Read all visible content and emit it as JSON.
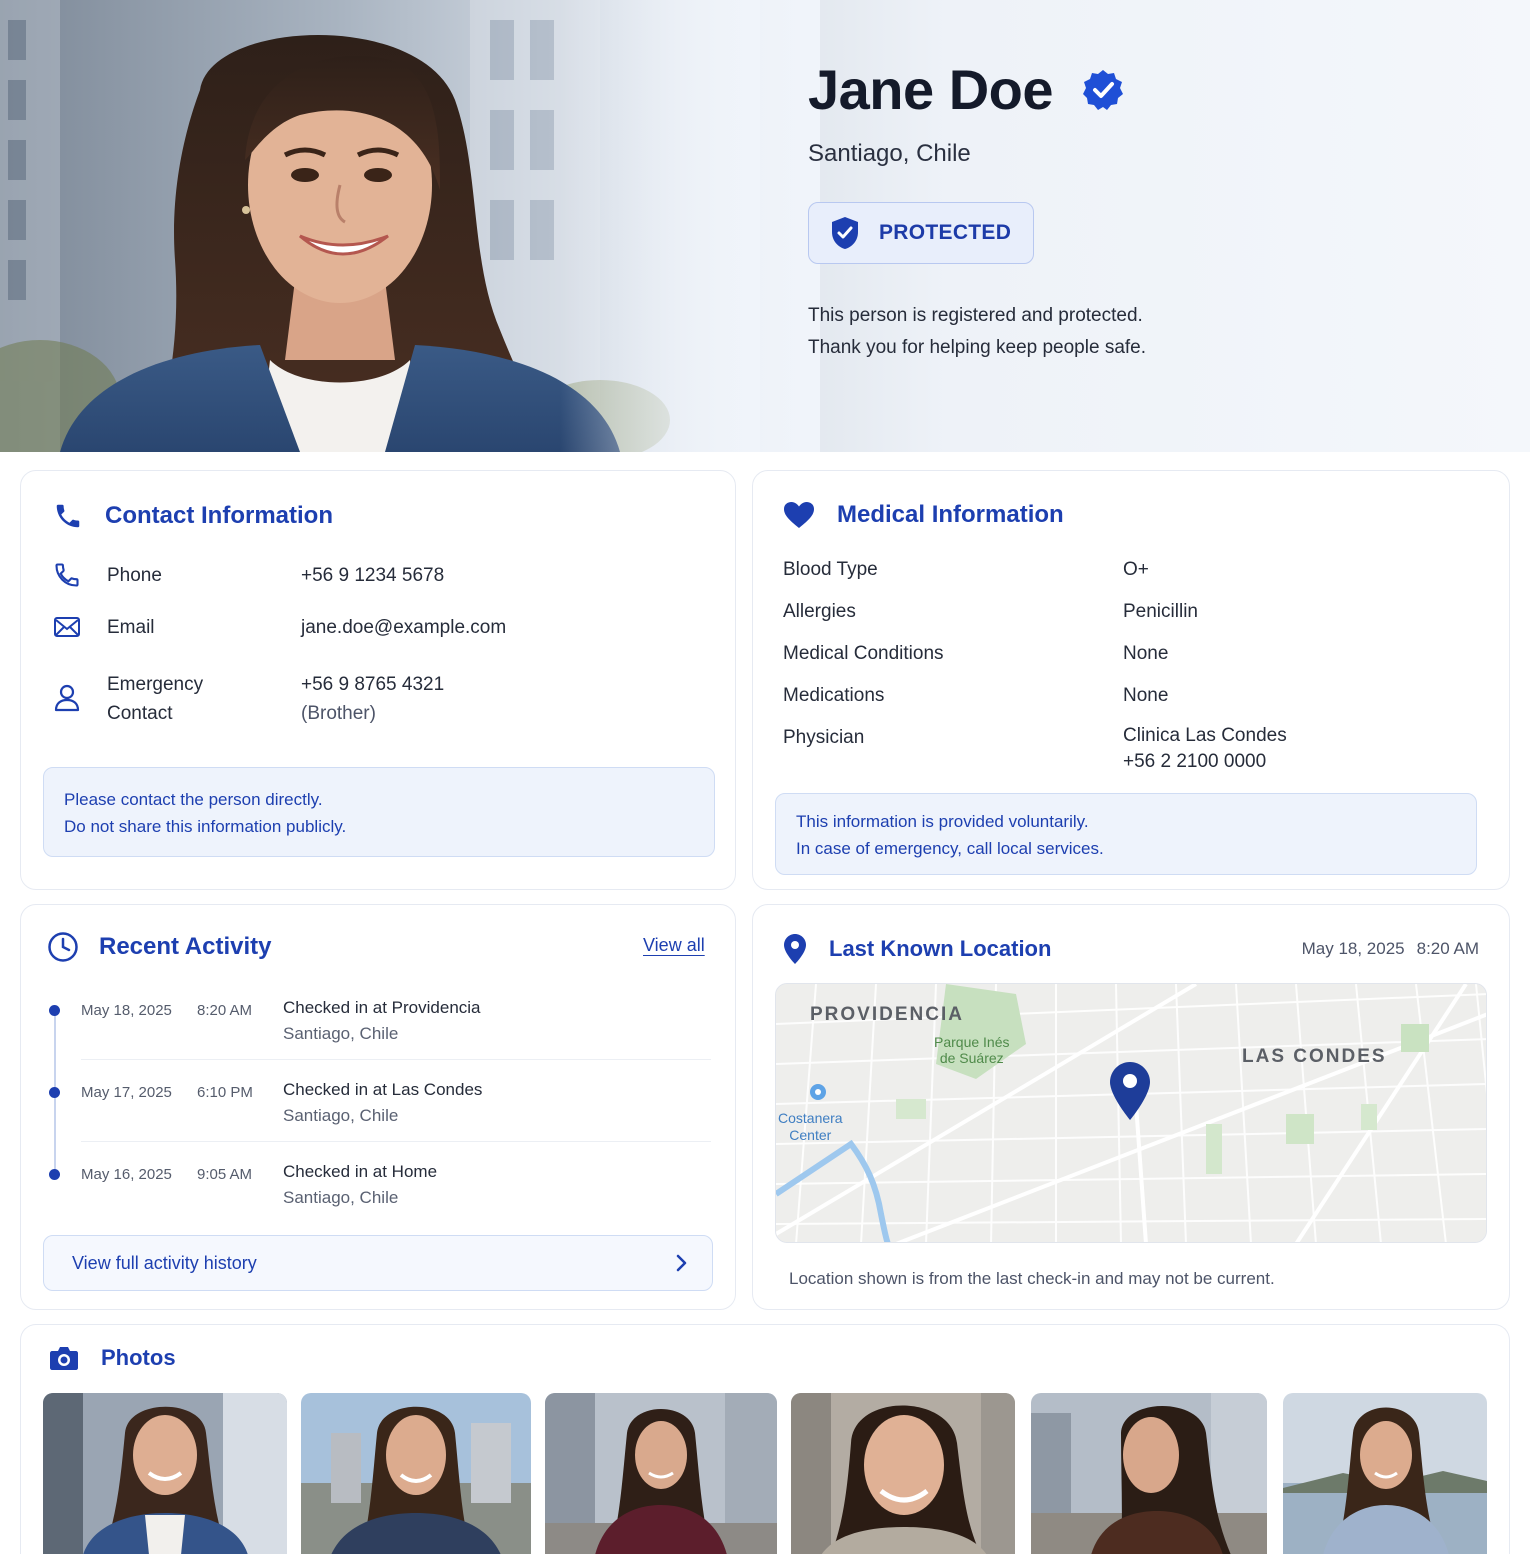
{
  "profile": {
    "name": "Jane Doe",
    "location": "Santiago, Chile",
    "status_badge": "PROTECTED",
    "message_line1": "This person is registered and protected.",
    "message_line2": "Thank you for helping keep people safe."
  },
  "contact": {
    "title": "Contact Information",
    "phone_label": "Phone",
    "phone_value": "+56 9 1234 5678",
    "email_label": "Email",
    "email_value": "jane.doe@example.com",
    "emergency_label_1": "Emergency",
    "emergency_label_2": "Contact",
    "emergency_value": "+56 9 8765 4321",
    "emergency_relation": "(Brother)",
    "note_line1": "Please contact the person directly.",
    "note_line2": "Do not share this information publicly."
  },
  "medical": {
    "title": "Medical Information",
    "rows": [
      {
        "label": "Blood Type",
        "value": "O+"
      },
      {
        "label": "Allergies",
        "value": "Penicillin"
      },
      {
        "label": "Medical Conditions",
        "value": "None"
      },
      {
        "label": "Medications",
        "value": "None"
      },
      {
        "label": "Physician",
        "value": "Clinica Las Condes"
      }
    ],
    "physician_phone": "+56 2 2100 0000",
    "note_line1": "This information is provided voluntarily.",
    "note_line2": "In case of emergency, call local services."
  },
  "activity": {
    "title": "Recent Activity",
    "view_all": "View all",
    "items": [
      {
        "date": "May 18, 2025",
        "time": "8:20 AM",
        "title": "Checked in at Providencia",
        "place": "Santiago, Chile"
      },
      {
        "date": "May 17, 2025",
        "time": "6:10 PM",
        "title": "Checked in at Las Condes",
        "place": "Santiago, Chile"
      },
      {
        "date": "May 16, 2025",
        "time": "9:05 AM",
        "title": "Checked in at Home",
        "place": "Santiago, Chile"
      }
    ],
    "history_button": "View full activity history"
  },
  "location": {
    "title": "Last Known Location",
    "date": "May 18, 2025",
    "time": "8:20 AM",
    "map_labels": {
      "providencia": "PROVIDENCIA",
      "las_condes": "LAS CONDES",
      "park_1": "Parque Inés",
      "park_2": "de Suárez",
      "costanera_1": "Costanera",
      "costanera_2": "Center"
    },
    "note": "Location shown is from the last check-in and may not be current."
  },
  "photos": {
    "title": "Photos",
    "count": 6
  },
  "colors": {
    "accent": "#1d3fb0",
    "note_bg": "#eef3fc",
    "border": "#e6eaf2"
  }
}
